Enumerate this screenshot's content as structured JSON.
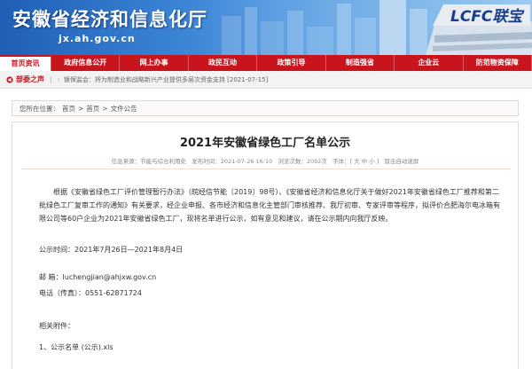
{
  "header": {
    "site_title": "安徽省经济和信息化厅",
    "site_url": "jx.ah.gov.cn",
    "logo_text": "LCFC联宝"
  },
  "nav": {
    "items": [
      {
        "label": "首页资讯",
        "active": true
      },
      {
        "label": "政府信息公开",
        "active": false
      },
      {
        "label": "网上办事",
        "active": false
      },
      {
        "label": "政民互动",
        "active": false
      },
      {
        "label": "政策引导",
        "active": false
      },
      {
        "label": "制造强省",
        "active": false
      },
      {
        "label": "企业云",
        "active": false
      },
      {
        "label": "防范物资保障",
        "active": false
      }
    ]
  },
  "notice": {
    "title": "部委之声",
    "text": "银保监会：将为制造业和战略新兴产业提供多层次资金支持 [2021-07-15]"
  },
  "breadcrumb": {
    "prefix": "您所在位置：",
    "items": [
      "首页",
      "首页",
      "文件公告"
    ],
    "sep": ">"
  },
  "article": {
    "title": "2021年安徽省绿色工厂名单公示",
    "meta": {
      "source": "信息来源：节能与综合利用处",
      "date": "发布时间：2021-07-26 16:10",
      "views": "浏览次数：2092次",
      "font": "字体：[ 大 中 小 ]",
      "close": "双击自动滚屏"
    },
    "paragraph": "根据《安徽省绿色工厂评价管理暂行办法》（皖经信节能〔2019〕98号）、《安徽省经济和信息化厅关于做好2021年安徽省绿色工厂推荐和第二批绿色工厂复审工作的通知》有关要求，经企业申报、各市经济和信息化主管部门审核推荐、我厅初审、专家评审等程序，拟评价合肥海尔电冰箱有限公司等60户企业为2021年安徽省绿色工厂，现将名单进行公示，如有意见和建议，请在公示期内向我厅反映。",
    "period": "公示时间：2021年7月26日—2021年8月4日",
    "email": "邮      箱：luchengjian@ahjxw.gov.cn",
    "phone": "电话（传真）：0551-62871724",
    "attach_label": "相关附件：",
    "attachment": "1、公示名单 (公示).xls"
  },
  "colors": {
    "nav_red": "#c8141c",
    "header_blue": "#1f5fb6"
  }
}
